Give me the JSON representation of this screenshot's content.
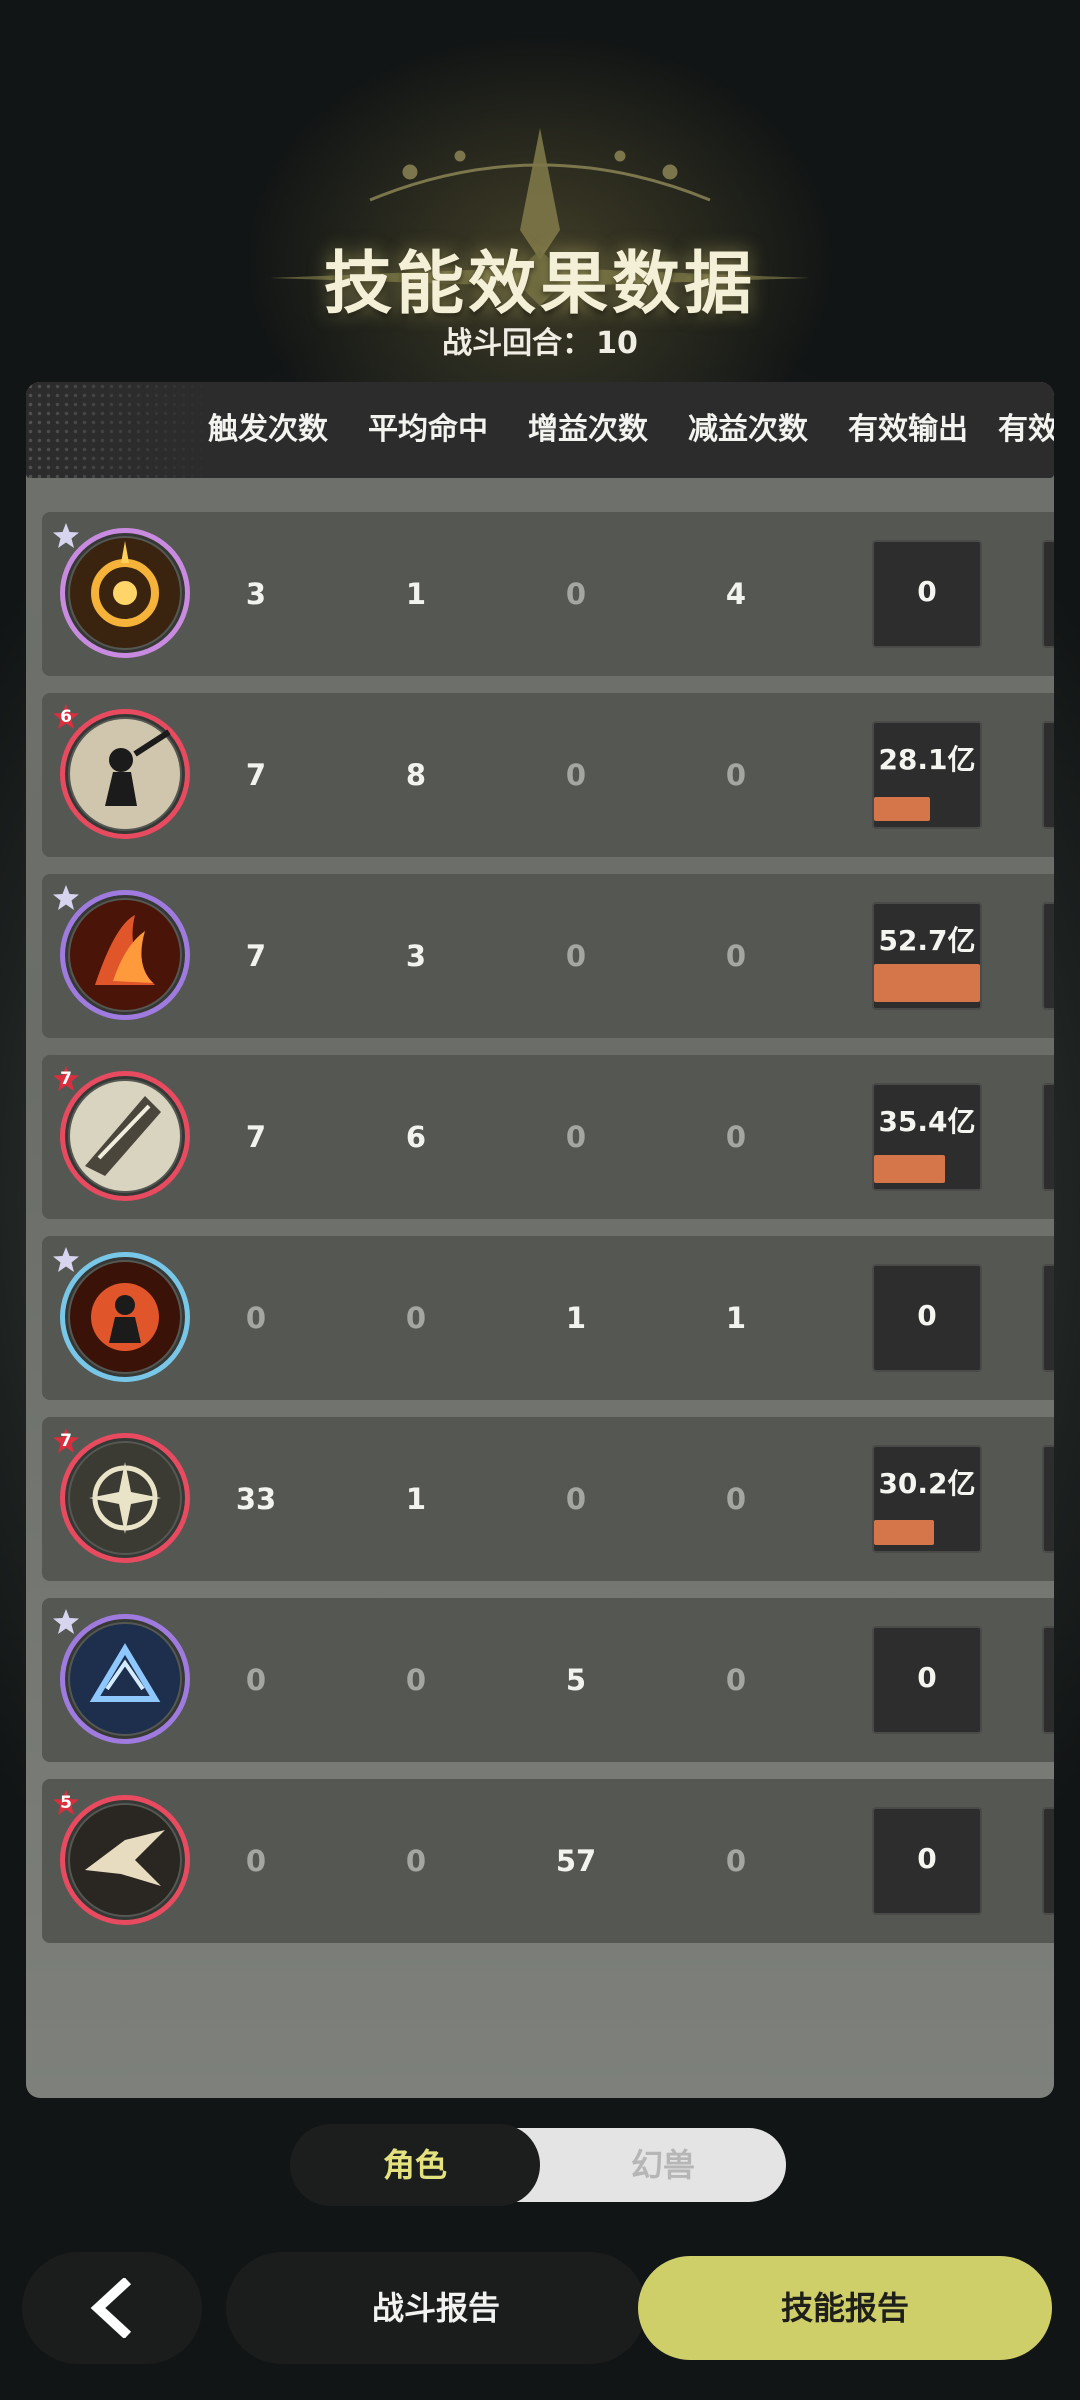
{
  "header": {
    "title": "技能效果数据",
    "round_label": "战斗回合：",
    "round_value": "10"
  },
  "columns": [
    "触发次数",
    "平均命中",
    "增益次数",
    "减益次数",
    "有效输出",
    "有效"
  ],
  "rows": [
    {
      "icon": "golden-ring-skill-icon",
      "badge": "",
      "ring": "mix",
      "trigger": "3",
      "hit": "1",
      "buff": "0",
      "debuff": "4",
      "output": "0",
      "output_ratio": 0
    },
    {
      "icon": "shadow-warrior-skill-icon",
      "badge": "6",
      "ring": "red",
      "trigger": "7",
      "hit": "8",
      "buff": "0",
      "debuff": "0",
      "output": "28.1亿",
      "output_ratio": 0.53
    },
    {
      "icon": "flame-claw-skill-icon",
      "badge": "",
      "ring": "purple",
      "trigger": "7",
      "hit": "3",
      "buff": "0",
      "debuff": "0",
      "output": "52.7亿",
      "output_ratio": 1.0
    },
    {
      "icon": "blade-slash-skill-icon",
      "badge": "7",
      "ring": "red",
      "trigger": "7",
      "hit": "6",
      "buff": "0",
      "debuff": "0",
      "output": "35.4亿",
      "output_ratio": 0.67
    },
    {
      "icon": "fire-figure-skill-icon",
      "badge": "",
      "ring": "blue",
      "trigger": "0",
      "hit": "0",
      "buff": "1",
      "debuff": "1",
      "output": "0",
      "output_ratio": 0
    },
    {
      "icon": "compass-star-skill-icon",
      "badge": "7",
      "ring": "red",
      "trigger": "33",
      "hit": "1",
      "buff": "0",
      "debuff": "0",
      "output": "30.2亿",
      "output_ratio": 0.57
    },
    {
      "icon": "ice-crest-skill-icon",
      "badge": "",
      "ring": "purple",
      "trigger": "0",
      "hit": "0",
      "buff": "5",
      "debuff": "0",
      "output": "0",
      "output_ratio": 0
    },
    {
      "icon": "spike-burst-skill-icon",
      "badge": "5",
      "ring": "red",
      "trigger": "0",
      "hit": "0",
      "buff": "57",
      "debuff": "0",
      "output": "0",
      "output_ratio": 0
    }
  ],
  "toggle": {
    "selected": "角色",
    "other": "幻兽"
  },
  "bottom": {
    "report_label": "战斗报告",
    "skill_label": "技能报告"
  },
  "colors": {
    "accent": "#cfcf6a",
    "output_bar": "#d4764a",
    "ring_red": "#e84a5f"
  }
}
